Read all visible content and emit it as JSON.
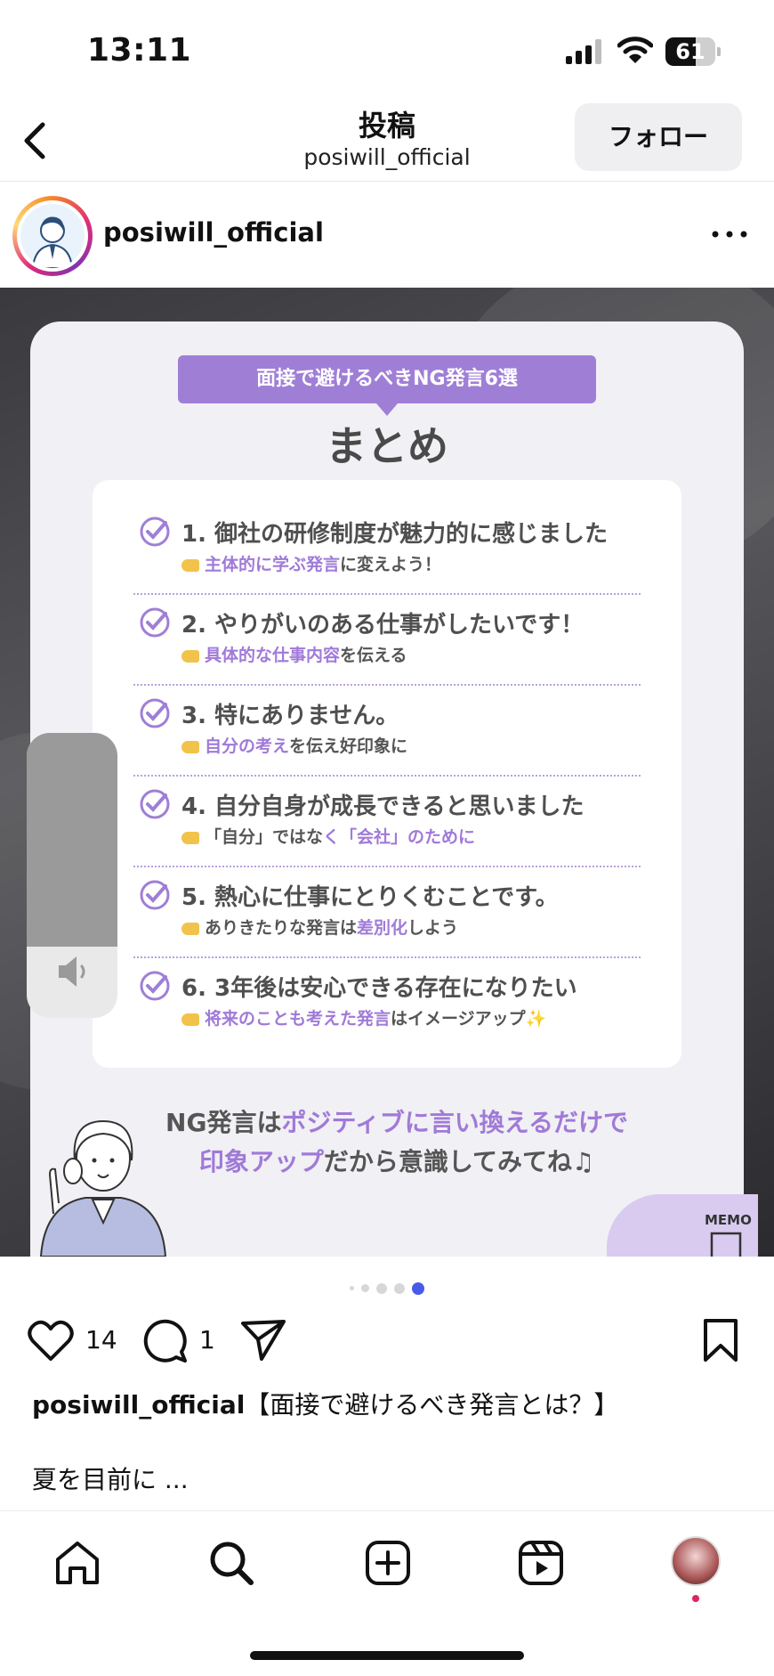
{
  "status_bar": {
    "time": "13:11",
    "battery": "61",
    "battery_level": 0.61
  },
  "header": {
    "title": "投稿",
    "subtitle": "posiwill_official",
    "follow_label": "フォロー"
  },
  "post": {
    "username": "posiwill_official",
    "slide": {
      "banner": "面接で避けるべきNG発言6選",
      "title": "まとめ",
      "items": [
        {
          "main": "1. 御社の研修制度が魅力的に感じました",
          "hl": "主体的に学ぶ発言",
          "rest": "に変えよう！"
        },
        {
          "main": "2. やりがいのある仕事がしたいです！",
          "hl": "具体的な仕事内容",
          "rest": "を伝える"
        },
        {
          "main": "3. 特にありません。",
          "hl": "自分の考え",
          "rest": "を伝え好印象に"
        },
        {
          "main": "4. 自分自身が成長できると思いました",
          "pre": "「自分」ではな",
          "hl": "く「会社」のために",
          "rest": ""
        },
        {
          "main": "5. 熱心に仕事にとりくむことです。",
          "pre": "ありきたりな発言は",
          "hl": "差別化",
          "rest": "しよう"
        },
        {
          "main": "6. 3年後は安心できる存在になりたい",
          "hl": "将来のことも考えた発言",
          "rest": "はイメージアップ✨"
        }
      ],
      "bottom_line1_pre": "NG発言は",
      "bottom_line1_hl": "ポジティブに言い換えるだけで",
      "bottom_line2_hl": "印象アップ",
      "bottom_line2_rest": "だから意識してみてね♫",
      "memo_label": "MEMO"
    },
    "volume_level": 0.75,
    "carousel": {
      "count": 5,
      "active_index": 4
    },
    "likes": "14",
    "comments": "1",
    "caption_user": "posiwill_official",
    "caption_text": "【面接で避けるべき発言とは？】",
    "caption_more": "夏を目前に ..."
  },
  "colors": {
    "accent_purple": "#9f7fd6",
    "dot_active": "#4a5ae8",
    "notification_dot": "#e0245e"
  }
}
